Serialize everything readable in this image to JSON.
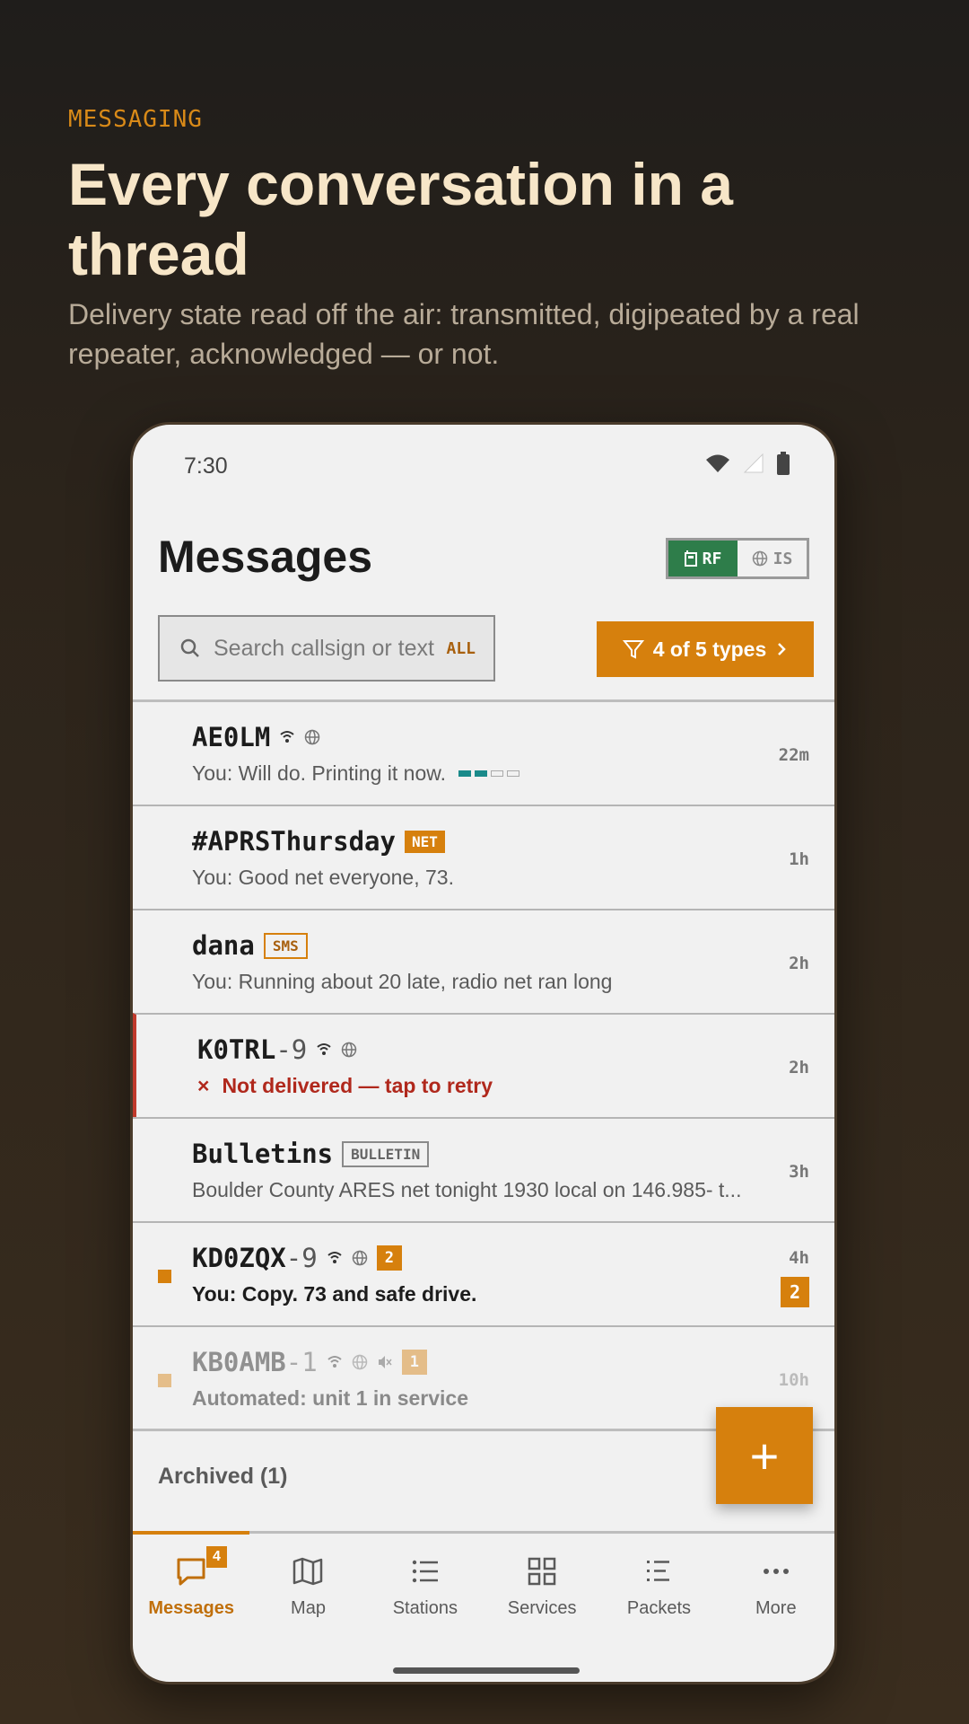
{
  "hero": {
    "eyebrow": "MESSAGING",
    "headline": "Every conversation in a thread",
    "subhead": "Delivery state read off the air: transmitted, digipeated by a real repeater, acknowledged — or not."
  },
  "statusbar": {
    "time": "7:30"
  },
  "header": {
    "title": "Messages",
    "toggle": {
      "rf": "RF",
      "is": "IS"
    }
  },
  "search": {
    "placeholder": "Search callsign or text",
    "scope": "ALL"
  },
  "filter": {
    "label": "4 of 5 types"
  },
  "threads": [
    {
      "callsign": "AE0LM",
      "ssid": "",
      "tag": "",
      "preview": "You: Will do. Printing it now.",
      "ago": "22m",
      "delivery_steps": 4,
      "delivery_done": 2
    },
    {
      "callsign": "#APRSThursday",
      "ssid": "",
      "tag": "NET",
      "preview": "You: Good net everyone, 73.",
      "ago": "1h"
    },
    {
      "callsign": "dana",
      "ssid": "",
      "tag": "SMS",
      "preview": "You: Running about 20 late, radio net ran long",
      "ago": "2h"
    },
    {
      "callsign": "K0TRL",
      "ssid": "-9",
      "tag": "",
      "preview": "Not delivered — tap to retry",
      "error_mark": "×",
      "ago": "2h",
      "state": "failed"
    },
    {
      "callsign": "Bulletins",
      "ssid": "",
      "tag": "BULLETIN",
      "preview": "Boulder County ARES net tonight 1930 local on 146.985- t...",
      "ago": "3h"
    },
    {
      "callsign": "KD0ZQX",
      "ssid": "-9",
      "tag": "",
      "count": "2",
      "preview": "You: Copy. 73 and safe drive.",
      "ago": "4h",
      "unread": "2"
    },
    {
      "callsign": "KB0AMB",
      "ssid": "-1",
      "tag": "",
      "count": "1",
      "preview": "Automated: unit 1 in service",
      "ago": "10h",
      "state": "muted"
    }
  ],
  "archived": {
    "label": "Archived (1)"
  },
  "fab": {
    "label": "+"
  },
  "nav": {
    "items": [
      {
        "label": "Messages",
        "badge": "4"
      },
      {
        "label": "Map"
      },
      {
        "label": "Stations"
      },
      {
        "label": "Services"
      },
      {
        "label": "Packets"
      },
      {
        "label": "More"
      }
    ]
  },
  "colors": {
    "accent": "#d6800d",
    "rf_green": "#2e7d4a",
    "error": "#c0392b",
    "delivery": "#1a8a8a"
  }
}
